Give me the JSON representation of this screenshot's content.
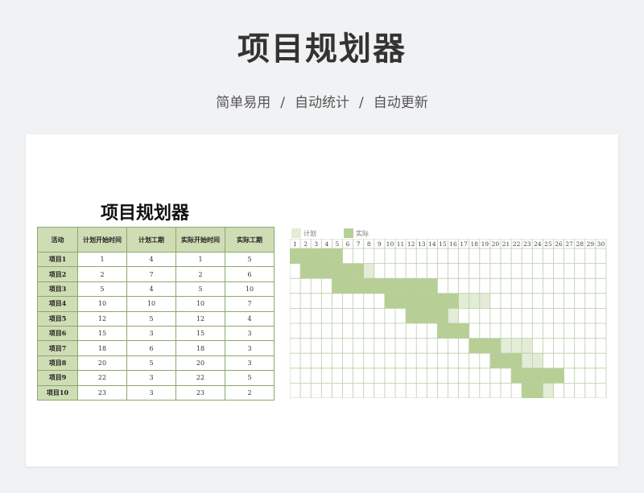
{
  "hero": {
    "title": "项目规划器",
    "subtitle_parts": [
      "简单易用",
      "/",
      "自动统计",
      "/",
      "自动更新"
    ]
  },
  "sheet": {
    "title": "项目规划器",
    "headers": [
      "活动",
      "计划开始时间",
      "计划工期",
      "实际开始时间",
      "实际工期"
    ],
    "rows": [
      {
        "name": "项目1",
        "plan_start": "1",
        "plan_dur": "4",
        "actual_start": "1",
        "actual_dur": "5"
      },
      {
        "name": "项目2",
        "plan_start": "2",
        "plan_dur": "7",
        "actual_start": "2",
        "actual_dur": "6"
      },
      {
        "name": "项目3",
        "plan_start": "5",
        "plan_dur": "4",
        "actual_start": "5",
        "actual_dur": "10"
      },
      {
        "name": "项目4",
        "plan_start": "10",
        "plan_dur": "10",
        "actual_start": "10",
        "actual_dur": "7"
      },
      {
        "name": "项目5",
        "plan_start": "12",
        "plan_dur": "5",
        "actual_start": "12",
        "actual_dur": "4"
      },
      {
        "name": "项目6",
        "plan_start": "15",
        "plan_dur": "3",
        "actual_start": "15",
        "actual_dur": "3"
      },
      {
        "name": "项目7",
        "plan_start": "18",
        "plan_dur": "6",
        "actual_start": "18",
        "actual_dur": "3"
      },
      {
        "name": "项目8",
        "plan_start": "20",
        "plan_dur": "5",
        "actual_start": "20",
        "actual_dur": "3"
      },
      {
        "name": "项目9",
        "plan_start": "22",
        "plan_dur": "3",
        "actual_start": "22",
        "actual_dur": "5"
      },
      {
        "name": "项目10",
        "plan_start": "23",
        "plan_dur": "3",
        "actual_start": "23",
        "actual_dur": "2"
      }
    ],
    "legend": {
      "plan": "计划",
      "actual": "实际"
    },
    "day_labels": [
      "1",
      "2",
      "3",
      "4",
      "5",
      "6",
      "7",
      "8",
      "9",
      "10",
      "11",
      "12",
      "13",
      "14",
      "15",
      "16",
      "17",
      "18",
      "19",
      "20",
      "21",
      "22",
      "23",
      "24",
      "25",
      "26",
      "27",
      "28",
      "29",
      "30"
    ]
  },
  "colors": {
    "plan_fill": "#e3ecd6",
    "actual_fill": "#b7cf95",
    "grid_line": "#b9cda6",
    "header_fill": "#cfddb5"
  }
}
